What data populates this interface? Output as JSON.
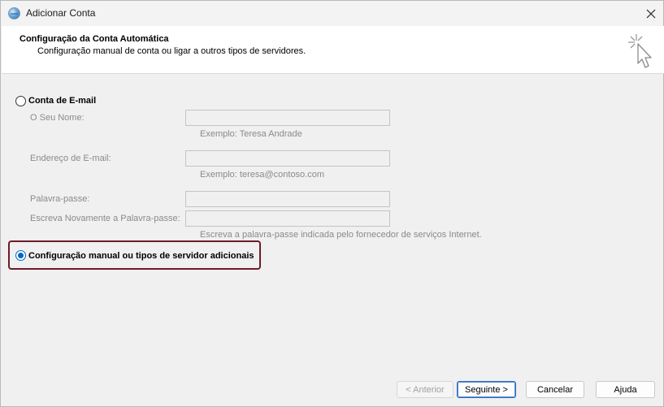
{
  "window": {
    "title": "Adicionar Conta"
  },
  "header": {
    "title": "Configuração da Conta Automática",
    "subtitle": "Configuração manual de conta ou ligar a outros tipos de servidores."
  },
  "email_account": {
    "label": "Conta de E-mail",
    "selected": false,
    "name_label": "O Seu Nome:",
    "name_value": "",
    "name_hint": "Exemplo: Teresa Andrade",
    "email_label": "Endereço de E-mail:",
    "email_value": "",
    "email_hint": "Exemplo: teresa@contoso.com",
    "password_label": "Palavra-passe:",
    "password_value": "",
    "confirm_label": "Escreva Novamente a Palavra-passe:",
    "confirm_value": "",
    "password_hint": "Escreva a palavra-passe indicada pelo fornecedor de serviços Internet."
  },
  "manual_setup": {
    "label": "Configuração manual ou tipos de servidor adicionais",
    "selected": true
  },
  "buttons": {
    "back": "< Anterior",
    "next": "Seguinte >",
    "cancel": "Cancelar",
    "help": "Ajuda"
  },
  "colors": {
    "accent": "#0067c0",
    "highlight_border": "#6e1a2a",
    "disabled_text": "#8a8a8a"
  }
}
